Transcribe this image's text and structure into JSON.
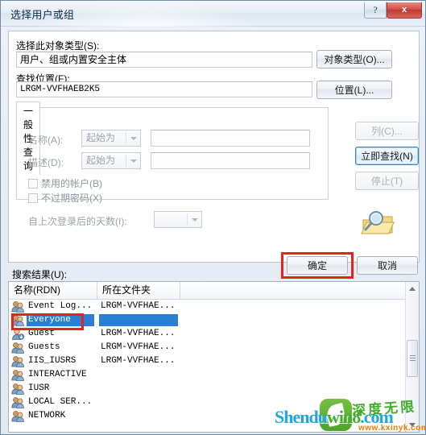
{
  "window": {
    "title": "选择用户或组",
    "help_label": "?",
    "close_label": "x"
  },
  "object_type": {
    "label": "选择此对象类型(S):",
    "value": "用户、组或内置安全主体",
    "button_label": "对象类型(O)..."
  },
  "location": {
    "label": "查找位置(F):",
    "value": "LRGM-VVFHAEB2K5",
    "button_label": "位置(L)..."
  },
  "query": {
    "tab_label": "一般性查询",
    "name": {
      "label": "名称(A):",
      "condition": "起始为",
      "value": ""
    },
    "description": {
      "label": "描述(D):",
      "condition": "起始为",
      "value": ""
    },
    "disabled_accounts_label": "禁用的帐户(B)",
    "non_expiring_password_label": "不过期密码(X)",
    "days_since_logon_label": "自上次登录后的天数(I):",
    "days_since_logon_value": ""
  },
  "side_buttons": {
    "columns_label": "列(C)...",
    "find_now_label": "立即查找(N)",
    "stop_label": "停止(T)"
  },
  "icons": {
    "search": "search-folder-icon"
  },
  "dialog_buttons": {
    "ok_label": "确定",
    "cancel_label": "取消"
  },
  "results": {
    "label": "搜索结果(U):",
    "columns": [
      "名称(RDN)",
      "所在文件夹"
    ],
    "rows": [
      {
        "name": "Event Log...",
        "folder": "LRGM-VVFHAE...",
        "selected": false,
        "icon": "group-icon"
      },
      {
        "name": "Everyone",
        "folder": "",
        "selected": true,
        "icon": "group-icon"
      },
      {
        "name": "Guest",
        "folder": "LRGM-VVFHAE...",
        "selected": false,
        "icon": "user-icon"
      },
      {
        "name": "Guests",
        "folder": "LRGM-VVFHAE...",
        "selected": false,
        "icon": "group-icon"
      },
      {
        "name": "IIS_IUSRS",
        "folder": "LRGM-VVFHAE...",
        "selected": false,
        "icon": "group-icon"
      },
      {
        "name": "INTERACTIVE",
        "folder": "",
        "selected": false,
        "icon": "group-icon"
      },
      {
        "name": "IUSR",
        "folder": "",
        "selected": false,
        "icon": "group-icon"
      },
      {
        "name": "LOCAL SER...",
        "folder": "",
        "selected": false,
        "icon": "group-icon"
      },
      {
        "name": "NETWORK",
        "folder": "",
        "selected": false,
        "icon": "group-icon"
      }
    ]
  },
  "watermark": {
    "text_shendu": "Shendu",
    "text_win8": "win8",
    "text_com": ".com",
    "chinese": "深度无限",
    "sub": "www.kxinyk.com"
  },
  "colors": {
    "selection": "#2a7fd4",
    "annotation": "#e8211a",
    "close_button": "#bd3a32"
  }
}
